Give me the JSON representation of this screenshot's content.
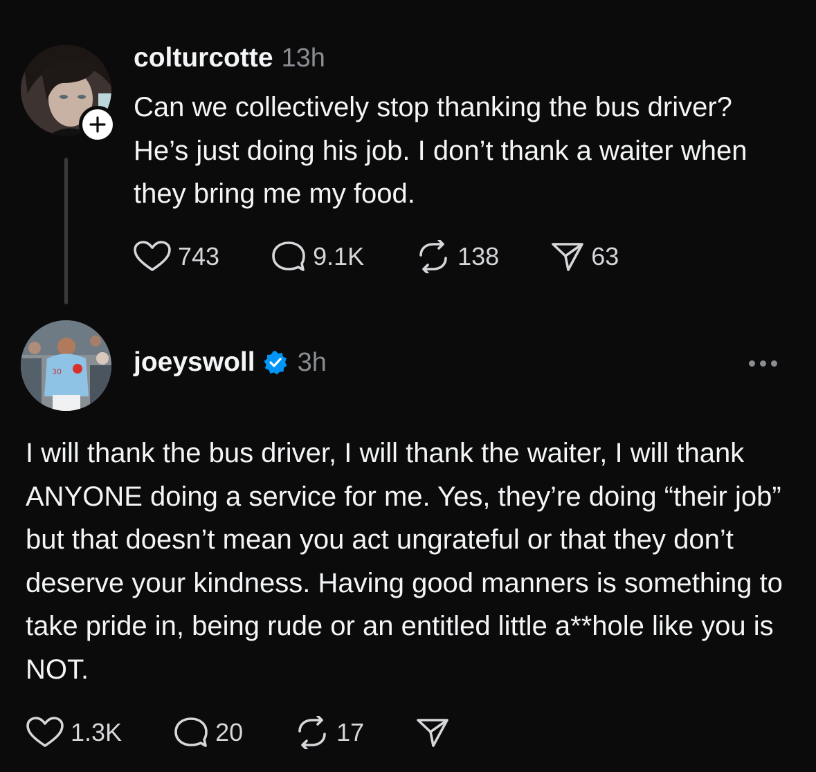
{
  "post": {
    "username": "colturcotte",
    "time": "13h",
    "text": "Can we collectively stop thanking the bus driver? He’s just doing his job. I don’t thank a waiter when they bring me my food.",
    "avatar_icon": "user-photo",
    "follow_icon": "plus-icon",
    "stats": {
      "likes": "743",
      "replies": "9.1K",
      "reposts": "138",
      "shares": "63"
    }
  },
  "reply": {
    "username": "joeyswoll",
    "verified_icon": "verified-badge-icon",
    "verified_color": "#0095f6",
    "time": "3h",
    "more_icon": "ellipsis-icon",
    "avatar_icon": "user-photo",
    "text": "I will thank the bus driver, I will thank the waiter, I will thank ANYONE doing a service for me. Yes, they’re doing “their job” but that doesn’t mean you act ungrateful or that they don’t deserve your kindness. Having good manners is something to take pride in, being rude or an entitled little a**hole like you is NOT.",
    "stats": {
      "likes": "1.3K",
      "replies": "20",
      "reposts": "17"
    }
  },
  "colors": {
    "background": "#0b0b0b",
    "primary_text": "#f3f5f7",
    "secondary_text": "#8a8d91"
  }
}
